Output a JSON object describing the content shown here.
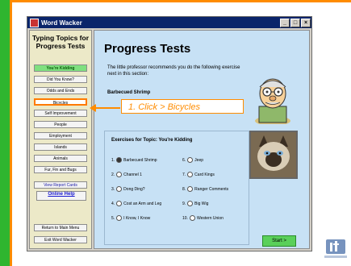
{
  "window": {
    "title": "Word Wacker",
    "controls": [
      "_",
      "□",
      "×"
    ]
  },
  "sidebar": {
    "title": "Typing Topics for Progress Tests",
    "items": [
      {
        "label": "You're Kidding",
        "state": "active"
      },
      {
        "label": "Did You Know?",
        "state": "normal"
      },
      {
        "label": "Odds and Ends",
        "state": "normal"
      },
      {
        "label": "Bicycles",
        "state": "highlighted"
      },
      {
        "label": "Self Improvement",
        "state": "normal"
      },
      {
        "label": "People",
        "state": "normal"
      },
      {
        "label": "Employment",
        "state": "normal"
      },
      {
        "label": "Islands",
        "state": "normal"
      },
      {
        "label": "Animals",
        "state": "normal"
      },
      {
        "label": "Fur, Fin and Bugs",
        "state": "normal"
      },
      {
        "label": "View Report Cards",
        "state": "blue"
      }
    ],
    "online_help": "Online Help",
    "bottom": [
      {
        "label": "Return to Main Menu"
      },
      {
        "label": "Exit Word Wacker"
      }
    ]
  },
  "main": {
    "title": "Progress Tests",
    "intro": "The little professor recommends you do the following exercise next in this section:",
    "recommended": "Barbecued Shrimp",
    "panel_heading": "Exercises for Topic:  You're Kidding",
    "exercises_left": [
      {
        "num": "1.",
        "label": "Barbecued Shrimp",
        "selected": true
      },
      {
        "num": "2.",
        "label": "Channel 1",
        "selected": false
      },
      {
        "num": "3.",
        "label": "Dong Ding?",
        "selected": false
      },
      {
        "num": "4.",
        "label": "Cost an Arm and Leg",
        "selected": false
      },
      {
        "num": "5.",
        "label": "I Know, I Know",
        "selected": false
      }
    ],
    "exercises_right": [
      {
        "num": "6.",
        "label": "Jeep",
        "selected": false
      },
      {
        "num": "7.",
        "label": "Card Kings",
        "selected": false
      },
      {
        "num": "8.",
        "label": "Ranger Comments",
        "selected": false
      },
      {
        "num": "9.",
        "label": "Big Wig",
        "selected": false
      },
      {
        "num": "10.",
        "label": "Western Union",
        "selected": false
      }
    ],
    "start_label": "Start >"
  },
  "callout": {
    "text": "1.  Click > Bicycles"
  },
  "colors": {
    "accent": "#ff8c00",
    "green": "#2fb52f",
    "panel": "#c7e1f5"
  }
}
